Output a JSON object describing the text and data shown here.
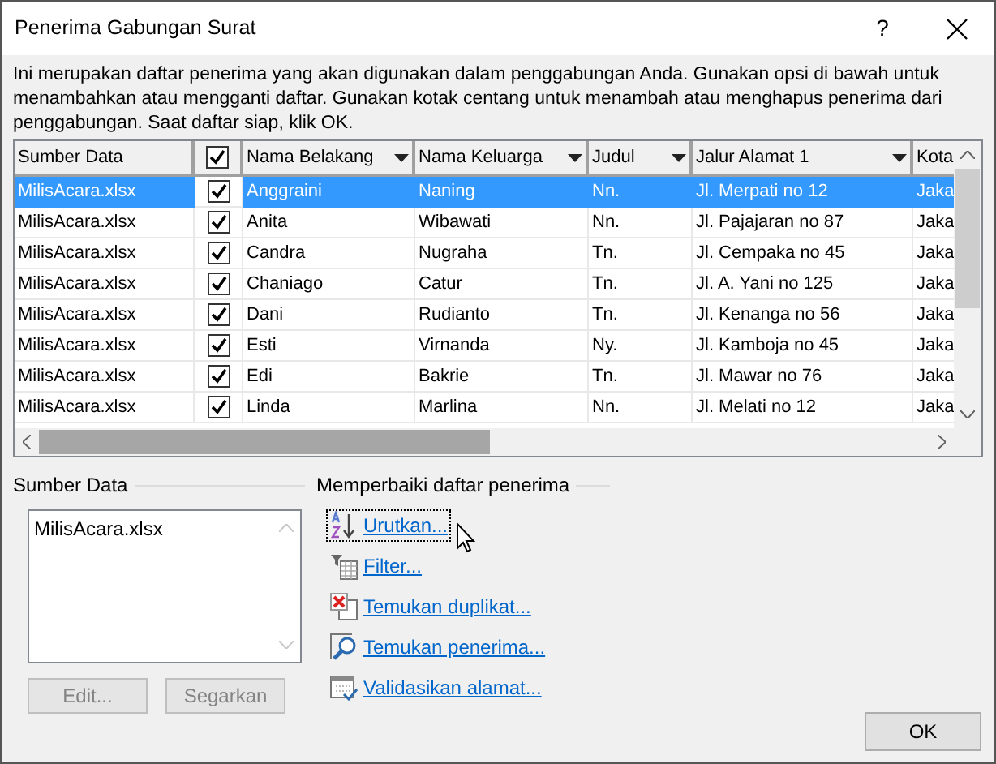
{
  "window": {
    "title": "Penerima Gabungan Surat",
    "help": "?"
  },
  "description": "Ini merupakan daftar penerima yang akan digunakan dalam penggabungan Anda. Gunakan opsi di bawah untuk menambahkan atau mengganti daftar. Gunakan kotak centang untuk menambah atau menghapus penerima dari penggabungan. Saat daftar siap, klik OK.",
  "table": {
    "header_checked": true,
    "columns": [
      {
        "label": "Sumber Data"
      },
      {
        "label": "Nama Belakang",
        "dropdown": true
      },
      {
        "label": "Nama Keluarga",
        "dropdown": true
      },
      {
        "label": "Judul",
        "dropdown": true
      },
      {
        "label": "Jalur Alamat 1",
        "dropdown": true
      },
      {
        "label": "Kota"
      }
    ],
    "rows": [
      {
        "selected": true,
        "checked": true,
        "cells": [
          "MilisAcara.xlsx",
          "Anggraini",
          "Naning",
          "Nn.",
          "Jl. Merpati no 12",
          "Jaka"
        ]
      },
      {
        "selected": false,
        "checked": true,
        "cells": [
          "MilisAcara.xlsx",
          "Anita",
          "Wibawati",
          "Nn.",
          "Jl. Pajajaran no 87",
          "Jaka"
        ]
      },
      {
        "selected": false,
        "checked": true,
        "cells": [
          "MilisAcara.xlsx",
          "Candra",
          "Nugraha",
          "Tn.",
          "Jl. Cempaka no 45",
          "Jaka"
        ]
      },
      {
        "selected": false,
        "checked": true,
        "cells": [
          "MilisAcara.xlsx",
          "Chaniago",
          "Catur",
          "Tn.",
          "Jl. A. Yani no 125",
          "Jaka"
        ]
      },
      {
        "selected": false,
        "checked": true,
        "cells": [
          "MilisAcara.xlsx",
          "Dani",
          "Rudianto",
          "Tn.",
          "Jl. Kenanga no 56",
          "Jaka"
        ]
      },
      {
        "selected": false,
        "checked": true,
        "cells": [
          "MilisAcara.xlsx",
          "Esti",
          "Virnanda",
          "Ny.",
          "Jl. Kamboja no 45",
          "Jaka"
        ]
      },
      {
        "selected": false,
        "checked": true,
        "cells": [
          "MilisAcara.xlsx",
          "Edi",
          "Bakrie",
          "Tn.",
          "Jl. Mawar no 76",
          "Jaka"
        ]
      },
      {
        "selected": false,
        "checked": true,
        "cells": [
          "MilisAcara.xlsx",
          "Linda",
          "Marlina",
          "Nn.",
          "Jl. Melati no 12",
          "Jaka"
        ]
      }
    ]
  },
  "data_source": {
    "title": "Sumber Data",
    "items": [
      "MilisAcara.xlsx"
    ],
    "buttons": [
      {
        "label": "Edit...",
        "disabled": true
      },
      {
        "label": "Segarkan",
        "disabled": true
      }
    ]
  },
  "refine": {
    "title": "Memperbaiki daftar penerima",
    "links": [
      {
        "label": "Urutkan...",
        "kind": "sort",
        "focused": true
      },
      {
        "label": "Filter...",
        "kind": "filter",
        "focused": false
      },
      {
        "label": "Temukan duplikat...",
        "kind": "duplicate",
        "focused": false
      },
      {
        "label": "Temukan penerima...",
        "kind": "find",
        "focused": false
      },
      {
        "label": "Validasikan alamat...",
        "kind": "validate",
        "focused": false
      }
    ]
  },
  "ok_button": "OK"
}
